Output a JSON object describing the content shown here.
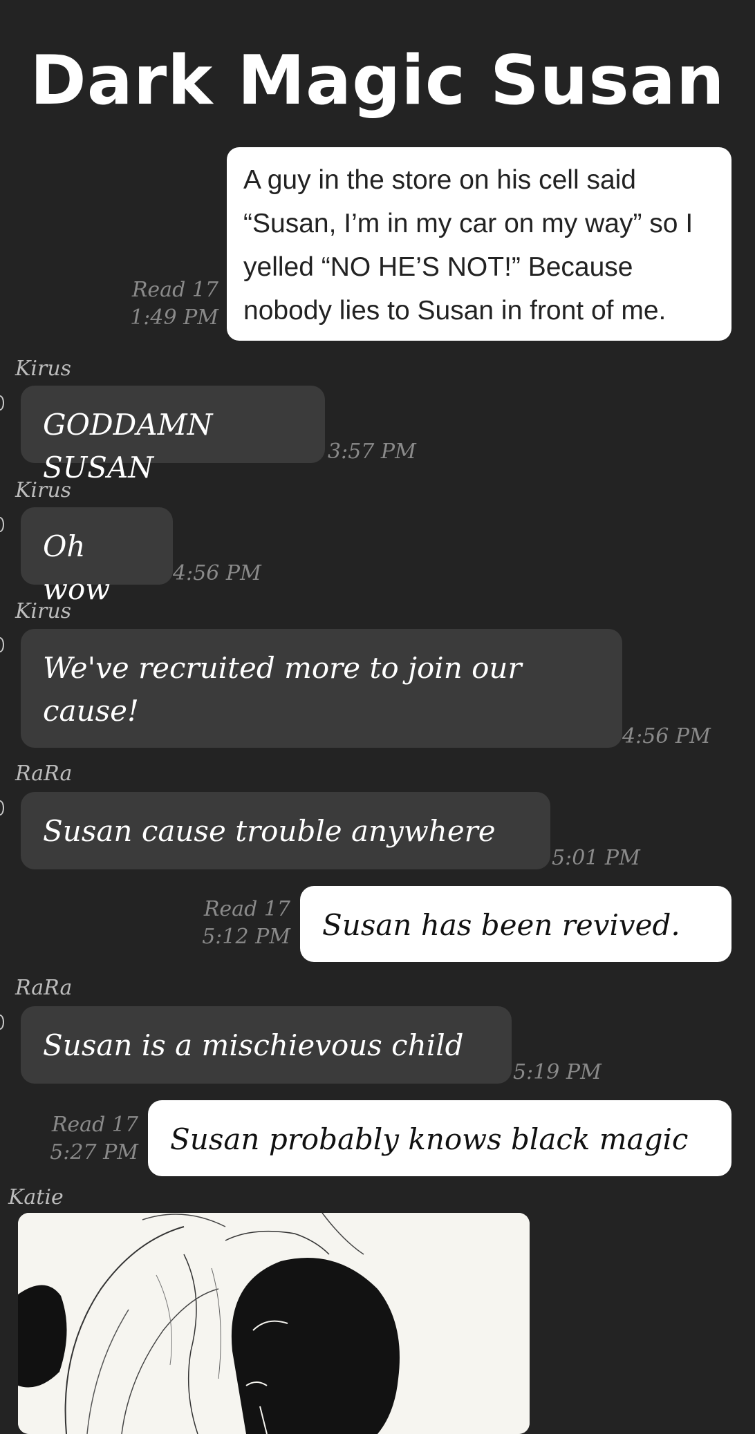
{
  "title": "Dark Magic Susan",
  "messages": [
    {
      "type": "outgoing-screenshot",
      "text": "A guy in the store on his cell said “Susan, I’m in my car on my way” so I yelled “NO HE’S NOT!” Because nobody lies to Susan in front of me.",
      "read": "Read 17",
      "time": "1:49 PM"
    },
    {
      "type": "incoming",
      "sender": "Kirus",
      "text": "GODDAMN SUSAN",
      "time": "3:57 PM"
    },
    {
      "type": "incoming",
      "sender": "Kirus",
      "text": "Oh wow",
      "time": "4:56 PM"
    },
    {
      "type": "incoming",
      "sender": "Kirus",
      "text": "We've recruited more to join our cause!",
      "time": "4:56 PM"
    },
    {
      "type": "incoming",
      "sender": "RaRa",
      "text": "Susan cause trouble anywhere",
      "time": "5:01 PM"
    },
    {
      "type": "outgoing",
      "text": "Susan has been revived.",
      "read": "Read 17",
      "time": "5:12 PM"
    },
    {
      "type": "incoming",
      "sender": "RaRa",
      "text": "Susan is a mischievous child",
      "time": "5:19 PM"
    },
    {
      "type": "outgoing",
      "text": "Susan probably knows black magic",
      "read": "Read 17",
      "time": "5:27 PM"
    },
    {
      "type": "incoming-image",
      "sender": "Katie",
      "image": "manga sketch of two dark-haired figures"
    }
  ]
}
